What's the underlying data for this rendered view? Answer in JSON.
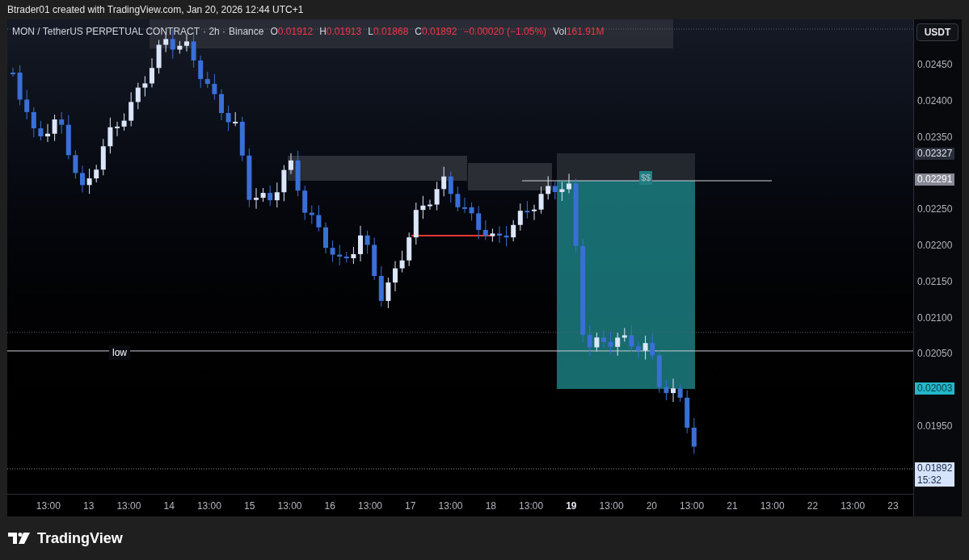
{
  "header": {
    "text": "Btrader01 created with TradingView.com, Jan 20, 2026 12:44 UTC+1"
  },
  "legend": {
    "symbol": "MON / TetherUS PERPETUAL CONTRACT",
    "interval": "· 2h ·",
    "exchange": "Binance",
    "ohlc": [
      {
        "label": "O",
        "value": "0.01912"
      },
      {
        "label": "H",
        "value": "0.01913"
      },
      {
        "label": "L",
        "value": "0.01868"
      },
      {
        "label": "C",
        "value": "0.01892"
      }
    ],
    "change": "−0.00020 (−1.05%)",
    "volume_label": "Vol",
    "volume": "161.91M"
  },
  "currency_button": "USDT",
  "price_axis": [
    {
      "text": "0.02450",
      "kind": "tick"
    },
    {
      "text": "0.02400",
      "kind": "tick"
    },
    {
      "text": "0.02350",
      "kind": "tick"
    },
    {
      "text": "0.02327",
      "kind": "zone"
    },
    {
      "text": "0.02291",
      "kind": "line"
    },
    {
      "text": "0.02250",
      "kind": "tick"
    },
    {
      "text": "0.02200",
      "kind": "tick"
    },
    {
      "text": "0.02150",
      "kind": "tick"
    },
    {
      "text": "0.02100",
      "kind": "tick"
    },
    {
      "text": "0.02050",
      "kind": "tick"
    },
    {
      "text": "0.02003",
      "kind": "target"
    },
    {
      "text": "0.01950",
      "kind": "tick"
    },
    {
      "text": "0.01892",
      "kind": "last",
      "countdown": "15:32"
    }
  ],
  "time_axis": [
    {
      "text": "13:00",
      "bold": false
    },
    {
      "text": "13",
      "bold": false
    },
    {
      "text": "13:00",
      "bold": false
    },
    {
      "text": "14",
      "bold": false
    },
    {
      "text": "13:00",
      "bold": false
    },
    {
      "text": "15",
      "bold": false
    },
    {
      "text": "13:00",
      "bold": false
    },
    {
      "text": "16",
      "bold": false
    },
    {
      "text": "13:00",
      "bold": false
    },
    {
      "text": "17",
      "bold": false
    },
    {
      "text": "13:00",
      "bold": false
    },
    {
      "text": "18",
      "bold": false
    },
    {
      "text": "13:00",
      "bold": false
    },
    {
      "text": "19",
      "bold": true
    },
    {
      "text": "13:00",
      "bold": false
    },
    {
      "text": "20",
      "bold": false
    },
    {
      "text": "13:00",
      "bold": false
    },
    {
      "text": "21",
      "bold": false
    },
    {
      "text": "13:00",
      "bold": false
    },
    {
      "text": "22",
      "bold": false
    },
    {
      "text": "13:00",
      "bold": false
    },
    {
      "text": "23",
      "bold": false
    }
  ],
  "annotations": [
    {
      "text": "low",
      "kind": "horizontal_line"
    },
    {
      "text": "$$",
      "kind": "liquidity_line"
    }
  ],
  "footer": {
    "logo": "TradingView"
  }
}
